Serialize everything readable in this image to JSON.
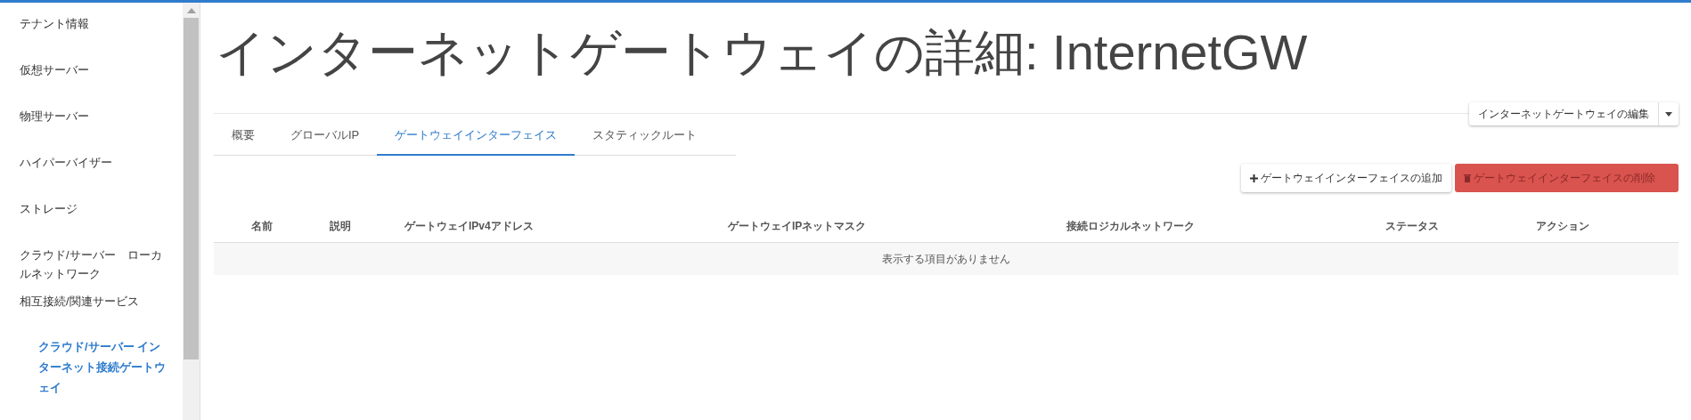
{
  "sidebar": {
    "items": [
      {
        "label": "テナント情報",
        "selected": false
      },
      {
        "label": "仮想サーバー",
        "selected": false
      },
      {
        "label": "物理サーバー",
        "selected": false
      },
      {
        "label": "ハイパーバイザー",
        "selected": false
      },
      {
        "label": "ストレージ",
        "selected": false
      },
      {
        "label": "クラウド/サーバー　ローカルネットワーク",
        "selected": false
      },
      {
        "label": "相互接続/関連サービス",
        "selected": false,
        "children": [
          {
            "label": "クラウド/サーバー インターネット接続ゲートウェイ",
            "selected": true
          }
        ]
      }
    ]
  },
  "page_title": "インターネットゲートウェイの詳細: InternetGW",
  "edit_button": {
    "label": "インターネットゲートウェイの編集"
  },
  "tabs": [
    {
      "label": "概要",
      "selected": false
    },
    {
      "label": "グローバルIP",
      "selected": false
    },
    {
      "label": "ゲートウェイインターフェイス",
      "selected": true
    },
    {
      "label": "スタティックルート",
      "selected": false
    }
  ],
  "actions": [
    {
      "label": "ゲートウェイインターフェイスの追加",
      "kind": "add",
      "disabled": false
    },
    {
      "label": "ゲートウェイインターフェイスの削除",
      "kind": "delete",
      "disabled": true
    }
  ],
  "table": {
    "columns": [
      "名前",
      "説明",
      "ゲートウェイIPv4アドレス",
      "ゲートウェイIPネットマスク",
      "接続ロジカルネットワーク",
      "ステータス",
      "アクション"
    ],
    "empty_message": "表示する項目がありません"
  }
}
